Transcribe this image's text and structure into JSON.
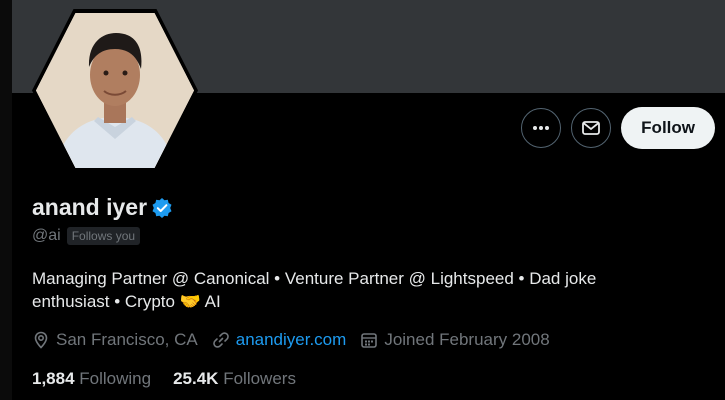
{
  "profile": {
    "name": "anand iyer",
    "verified": true,
    "handle": "@ai",
    "follows_you": "Follows you",
    "bio_line1": "Managing Partner @ Canonical • Venture Partner @ Lightspeed • Dad joke",
    "bio_line2_prefix": "enthusiast • Crypto ",
    "bio_emoji": "🤝",
    "bio_line2_suffix": " AI",
    "location": "San Francisco, CA",
    "website": "anandiyer.com",
    "joined": "Joined February 2008",
    "following_count": "1,884",
    "following_label": "Following",
    "followers_count": "25.4K",
    "followers_label": "Followers"
  },
  "actions": {
    "more_icon": "more-icon",
    "message_icon": "envelope-icon",
    "follow_label": "Follow"
  },
  "colors": {
    "background": "#000000",
    "banner": "#333639",
    "link": "#1d9bf0",
    "verified": "#1d9bf0",
    "secondary_text": "#71767b"
  }
}
